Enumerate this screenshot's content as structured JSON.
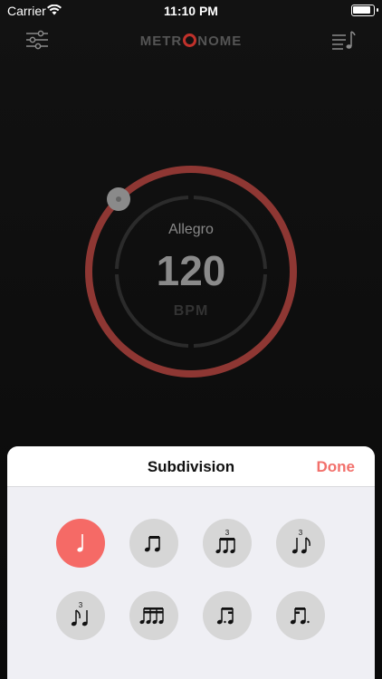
{
  "status_bar": {
    "carrier": "Carrier",
    "time": "11:10 PM"
  },
  "nav": {
    "title_left": "METR",
    "title_right": "NOME",
    "settings_icon": "sliders-icon",
    "playlist_icon": "music-list-icon"
  },
  "dial": {
    "tempo_name": "Allegro",
    "bpm": "120",
    "bpm_label": "BPM",
    "ring_color": "#8e3733"
  },
  "sheet": {
    "title": "Subdivision",
    "done_label": "Done",
    "accent_color": "#f56a66",
    "options": [
      {
        "name": "quarter-note",
        "selected": true,
        "triplet_mark": ""
      },
      {
        "name": "eighth-notes",
        "selected": false,
        "triplet_mark": ""
      },
      {
        "name": "eighth-triplet",
        "selected": false,
        "triplet_mark": "3"
      },
      {
        "name": "quarter-eighth-triplet",
        "selected": false,
        "triplet_mark": "3"
      },
      {
        "name": "eighth-quarter-triplet",
        "selected": false,
        "triplet_mark": "3"
      },
      {
        "name": "sixteenth-notes",
        "selected": false,
        "triplet_mark": ""
      },
      {
        "name": "dotted-eighth-sixteenth",
        "selected": false,
        "triplet_mark": ""
      },
      {
        "name": "sixteenth-dotted-eighth",
        "selected": false,
        "triplet_mark": ""
      }
    ]
  }
}
